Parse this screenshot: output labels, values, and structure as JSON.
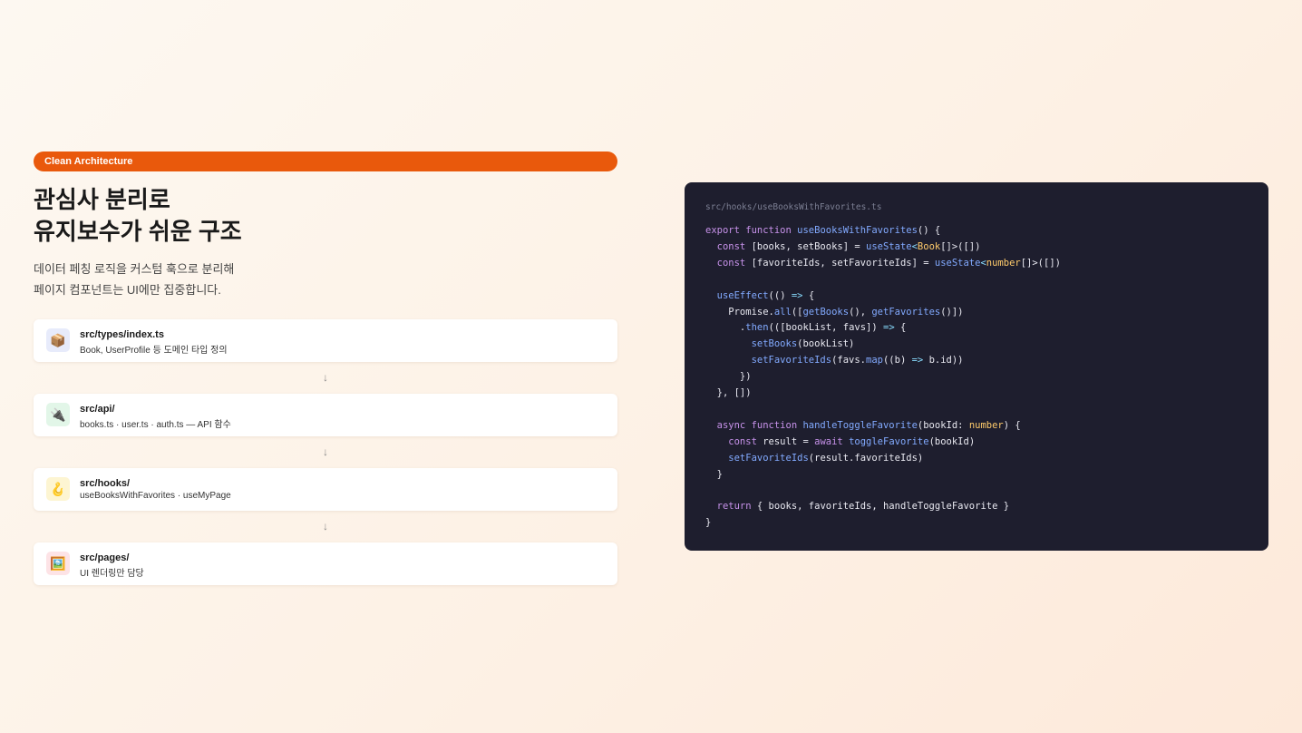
{
  "badge": "Clean Architecture",
  "title_line1": "관심사 분리로",
  "title_line2": "유지보수가 쉬운 구조",
  "subtitle_line1": "데이터 페칭 로직을 커스텀 훅으로 분리해",
  "subtitle_line2": "페이지 컴포넌트는 UI에만 집중합니다.",
  "arrow_glyph": "↓",
  "layers": [
    {
      "icon": "📦",
      "icon_name": "package-icon",
      "icon_bg": "#e7ebfb",
      "path": "src/types/index.ts",
      "desc": "Book, UserProfile 등 도메인 타입 정의"
    },
    {
      "icon": "🔌",
      "icon_name": "plug-icon",
      "icon_bg": "#e2f6e8",
      "path": "src/api/",
      "desc": "books.ts · user.ts · auth.ts — API 함수"
    },
    {
      "icon": "🪝",
      "icon_name": "hook-icon",
      "icon_bg": "#fdf5d2",
      "path": "src/hooks/",
      "desc": "useBooksWithFavorites · useMyPage"
    },
    {
      "icon": "🖼️",
      "icon_name": "picture-icon",
      "icon_bg": "#fde3e6",
      "path": "src/pages/",
      "desc": "UI 렌더링만 담당"
    }
  ],
  "code": {
    "filename": "src/hooks/useBooksWithFavorites.ts",
    "lines": [
      [
        [
          "kw",
          "export function "
        ],
        [
          "fn",
          "useBooksWithFavorites"
        ],
        [
          "pl",
          "() {"
        ]
      ],
      [
        [
          "kw",
          "  const "
        ],
        [
          "pl",
          "[books, setBooks] = "
        ],
        [
          "fn",
          "useState"
        ],
        [
          "op",
          "<"
        ],
        [
          "ty",
          "Book"
        ],
        [
          "pl",
          "[]>([])"
        ]
      ],
      [
        [
          "kw",
          "  const "
        ],
        [
          "pl",
          "[favoriteIds, setFavoriteIds] = "
        ],
        [
          "fn",
          "useState"
        ],
        [
          "op",
          "<"
        ],
        [
          "ty",
          "number"
        ],
        [
          "pl",
          "[]>([])"
        ]
      ],
      [],
      [
        [
          "fn",
          "  useEffect"
        ],
        [
          "pl",
          "(() "
        ],
        [
          "op",
          "=>"
        ],
        [
          "pl",
          " {"
        ]
      ],
      [
        [
          "pl",
          "    Promise."
        ],
        [
          "fn",
          "all"
        ],
        [
          "pl",
          "(["
        ],
        [
          "fn",
          "getBooks"
        ],
        [
          "pl",
          "(), "
        ],
        [
          "fn",
          "getFavorites"
        ],
        [
          "pl",
          "()])"
        ]
      ],
      [
        [
          "pl",
          "      ."
        ],
        [
          "fn",
          "then"
        ],
        [
          "pl",
          "(([bookList, favs]) "
        ],
        [
          "op",
          "=>"
        ],
        [
          "pl",
          " {"
        ]
      ],
      [
        [
          "fn",
          "        setBooks"
        ],
        [
          "pl",
          "(bookList)"
        ]
      ],
      [
        [
          "fn",
          "        setFavoriteIds"
        ],
        [
          "pl",
          "(favs."
        ],
        [
          "fn",
          "map"
        ],
        [
          "pl",
          "((b) "
        ],
        [
          "op",
          "=>"
        ],
        [
          "pl",
          " b.id))"
        ]
      ],
      [
        [
          "pl",
          "      })"
        ]
      ],
      [
        [
          "pl",
          "  }, [])"
        ]
      ],
      [],
      [
        [
          "kw",
          "  async function "
        ],
        [
          "fn",
          "handleToggleFavorite"
        ],
        [
          "pl",
          "(bookId: "
        ],
        [
          "ty",
          "number"
        ],
        [
          "pl",
          ") {"
        ]
      ],
      [
        [
          "kw",
          "    const "
        ],
        [
          "pl",
          "result = "
        ],
        [
          "kw",
          "await "
        ],
        [
          "fn",
          "toggleFavorite"
        ],
        [
          "pl",
          "(bookId)"
        ]
      ],
      [
        [
          "fn",
          "    setFavoriteIds"
        ],
        [
          "pl",
          "(result.favoriteIds)"
        ]
      ],
      [
        [
          "pl",
          "  }"
        ]
      ],
      [],
      [
        [
          "kw",
          "  return "
        ],
        [
          "pl",
          "{ books, favoriteIds, handleToggleFavorite }"
        ]
      ],
      [
        [
          "pl",
          "}"
        ]
      ]
    ]
  }
}
